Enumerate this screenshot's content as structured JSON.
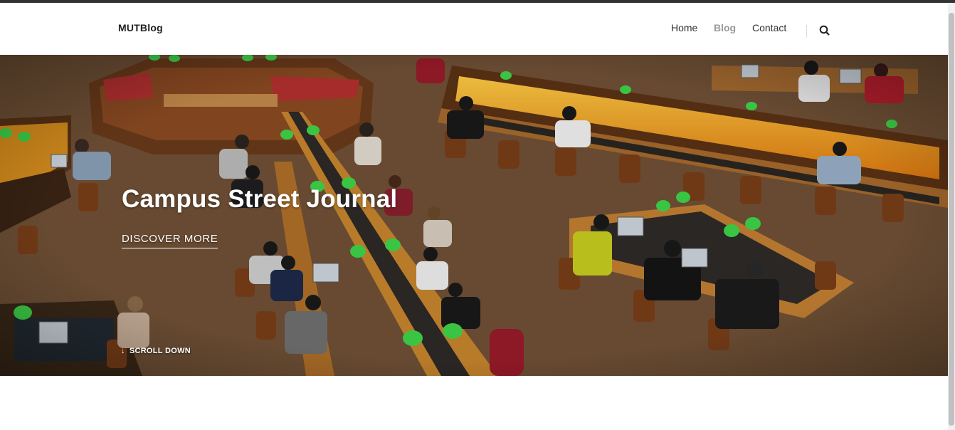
{
  "brand": {
    "name": "MUTBlog"
  },
  "nav": {
    "items": [
      {
        "label": "Home",
        "active": false
      },
      {
        "label": "Blog",
        "active": true
      },
      {
        "label": "Contact",
        "active": false
      }
    ],
    "search_icon": "search-icon"
  },
  "hero": {
    "title": "Campus Street Journal",
    "cta": "DISCOVER MORE",
    "scroll": "SCROLL DOWN",
    "scroll_icon": "arrow-down-icon"
  },
  "colors": {
    "text_dark": "#222222",
    "nav_active": "#999999",
    "hero_text": "#ffffff"
  }
}
